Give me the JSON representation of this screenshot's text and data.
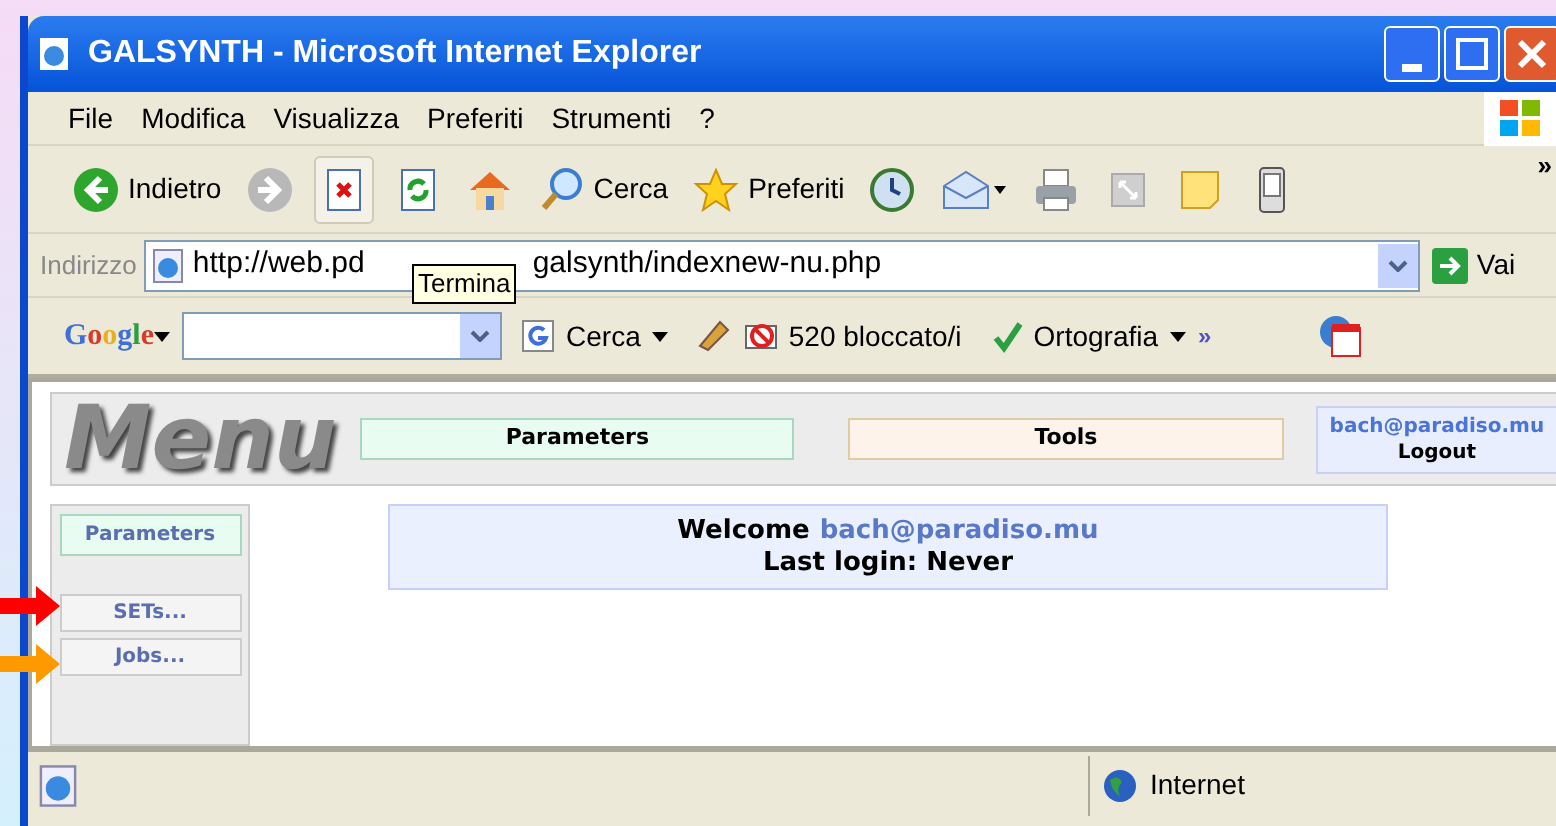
{
  "window": {
    "title": "GALSYNTH - Microsoft Internet Explorer"
  },
  "menu_bar": [
    "File",
    "Modifica",
    "Visualizza",
    "Preferiti",
    "Strumenti",
    "?"
  ],
  "toolbar": [
    {
      "kind": "back",
      "label": "Indietro"
    },
    {
      "kind": "forward"
    },
    {
      "kind": "stop"
    },
    {
      "kind": "refresh"
    },
    {
      "kind": "home"
    },
    {
      "kind": "search",
      "label": "Cerca"
    },
    {
      "kind": "favorites",
      "label": "Preferiti"
    },
    {
      "kind": "history"
    },
    {
      "kind": "mail"
    },
    {
      "kind": "print"
    },
    {
      "kind": "fullscreen"
    },
    {
      "kind": "note"
    },
    {
      "kind": "device"
    }
  ],
  "toolbar_more": "»",
  "address_bar": {
    "label": "Indirizzo",
    "url_start": "http://web.pd",
    "url_end": "galsynth/indexnew-nu.php",
    "go": "Vai"
  },
  "tooltip": {
    "text": "Termina"
  },
  "google_bar": {
    "logo": "Google",
    "search_button": "Cerca",
    "blocked": "520 bloccato/i",
    "spell": "Ortografia",
    "more": "»"
  },
  "page": {
    "logo": "Menu",
    "tabs": [
      {
        "label": "Parameters",
        "color": "#e8fcf2"
      },
      {
        "label": "Tools",
        "color": "#fdf3ea"
      }
    ],
    "user": {
      "email": "bach@paradiso.mu",
      "logout": "Logout"
    },
    "sidebar": {
      "heading": "Parameters",
      "items": [
        "SETs...",
        "Jobs..."
      ]
    },
    "welcome": {
      "greeting": "Welcome",
      "email": "bach@paradiso.mu",
      "last_login": "Last login: Never"
    }
  },
  "status_bar": {
    "zone": "Internet"
  },
  "annotation_arrows": [
    {
      "color": "#ff0000"
    },
    {
      "color": "#ff9900"
    }
  ]
}
